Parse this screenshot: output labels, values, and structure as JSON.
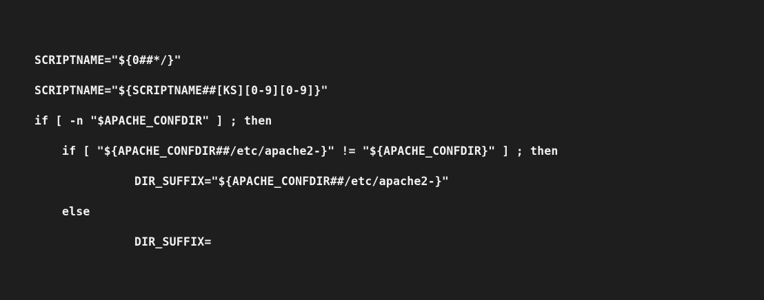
{
  "code": {
    "lines": [
      "SCRIPTNAME=\"${0##*/}\"",
      "SCRIPTNAME=\"${SCRIPTNAME##[KS][0-9][0-9]}\"",
      "if [ -n \"$APACHE_CONFDIR\" ] ; then",
      "if [ \"${APACHE_CONFDIR##/etc/apache2-}\" != \"${APACHE_CONFDIR}\" ] ; then",
      "DIR_SUFFIX=\"${APACHE_CONFDIR##/etc/apache2-}\"",
      "else",
      "DIR_SUFFIX="
    ]
  },
  "colors": {
    "background": "#1e1e1e",
    "text": "#f2f2f2"
  }
}
